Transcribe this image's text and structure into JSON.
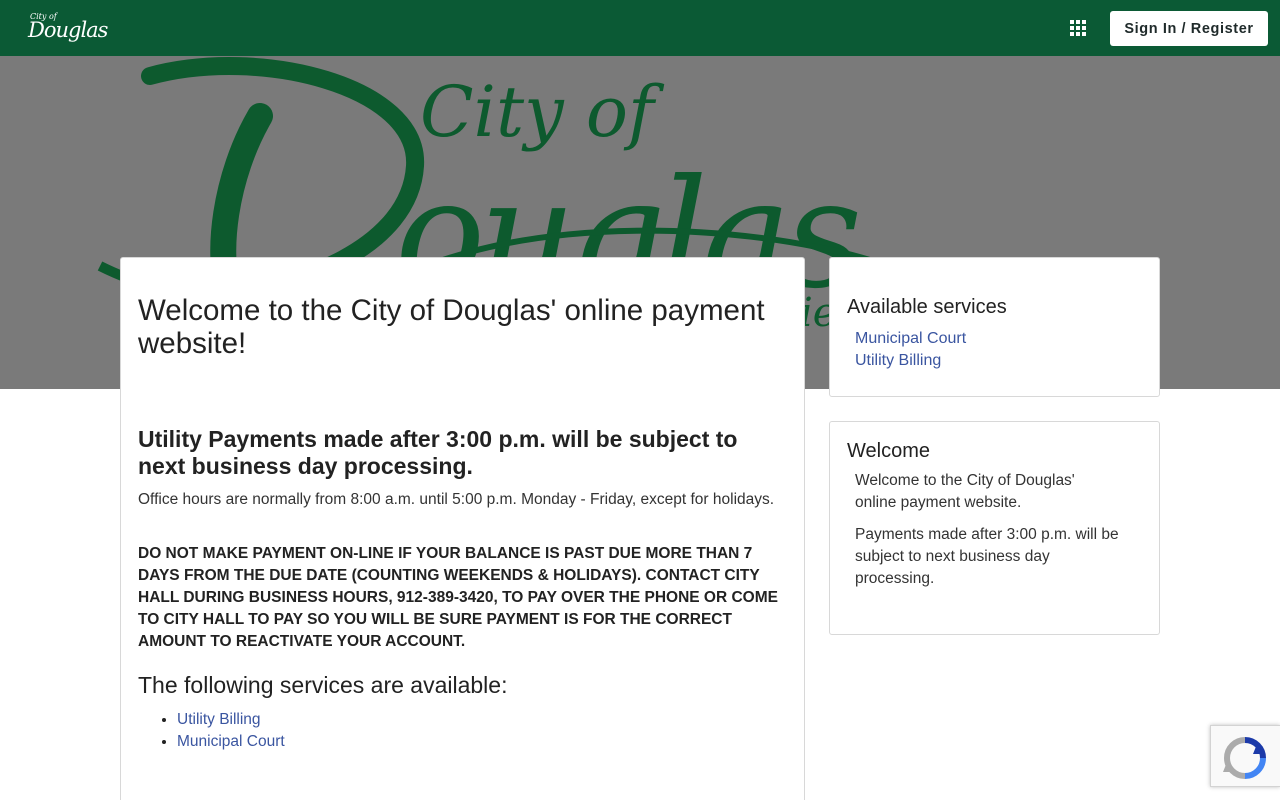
{
  "header": {
    "logo_small": "City of",
    "logo_big": "Douglas",
    "apps_icon": "grid-icon",
    "signin_label": "Sign In / Register",
    "bg_color": "#0b5a35"
  },
  "hero": {
    "line1": "City of",
    "line2": "Douglas"
  },
  "main": {
    "title": "Welcome to the City of Douglas' online payment website!",
    "notice_heading": "Utility Payments made after 3:00 p.m. will be subject to next business day processing.",
    "hours_text": "Office hours are normally from 8:00 a.m. until 5:00 p.m. Monday - Friday, except for holidays.",
    "warning_text": "DO NOT MAKE PAYMENT ON-LINE IF YOUR BALANCE IS PAST DUE MORE THAN 7 DAYS FROM THE DUE DATE (COUNTING WEEKENDS & HOLIDAYS).  CONTACT CITY HALL DURING BUSINESS HOURS, 912-389-3420, TO PAY OVER THE PHONE OR COME TO CITY HALL TO PAY SO YOU WILL BE SURE PAYMENT IS FOR THE CORRECT AMOUNT TO REACTIVATE YOUR ACCOUNT.",
    "services_heading": "The following services are available:",
    "services": [
      "Utility Billing",
      "Municipal Court"
    ]
  },
  "sidebar": {
    "services_title": "Available services",
    "services": [
      "Municipal Court",
      "Utility Billing"
    ],
    "welcome_title": "Welcome",
    "welcome_p1": "Welcome to the City of Douglas' online payment website.",
    "welcome_p2": "Payments made after 3:00 p.m. will be subject to next business day processing."
  },
  "colors": {
    "link": "#3a55a0",
    "brand_green": "#0b5a35"
  }
}
